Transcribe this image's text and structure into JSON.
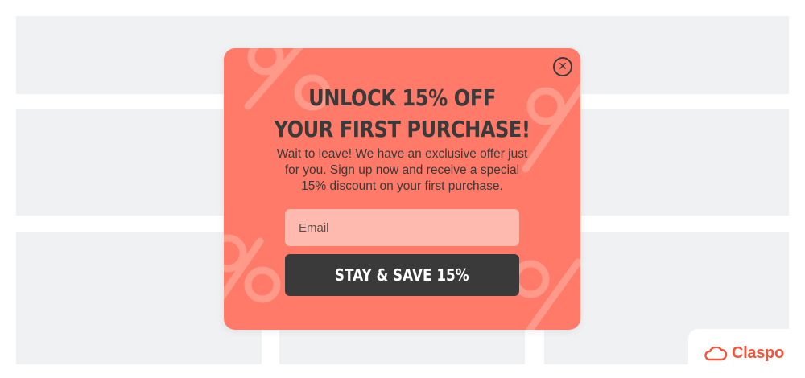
{
  "popup": {
    "title_line1": "UNLOCK 15% OFF",
    "title_line2": "YOUR FIRST PURCHASE!",
    "description_line1": "Wait to leave! We have an exclusive offer just",
    "description_line2": "for you. Sign up now and receive a special",
    "description_line3": "15% discount on your first purchase.",
    "email_placeholder": "Email",
    "cta_label": "STAY & SAVE 15%",
    "close_icon": "close-icon"
  },
  "brand": {
    "name": "Claspo",
    "icon": "cloud-icon"
  },
  "colors": {
    "popup_background": "#ff7a68",
    "cta_background": "#3a3a3a",
    "email_background": "#ffbab0",
    "brand": "#f1553b",
    "placeholder_blocks": "#f0f1f3"
  }
}
